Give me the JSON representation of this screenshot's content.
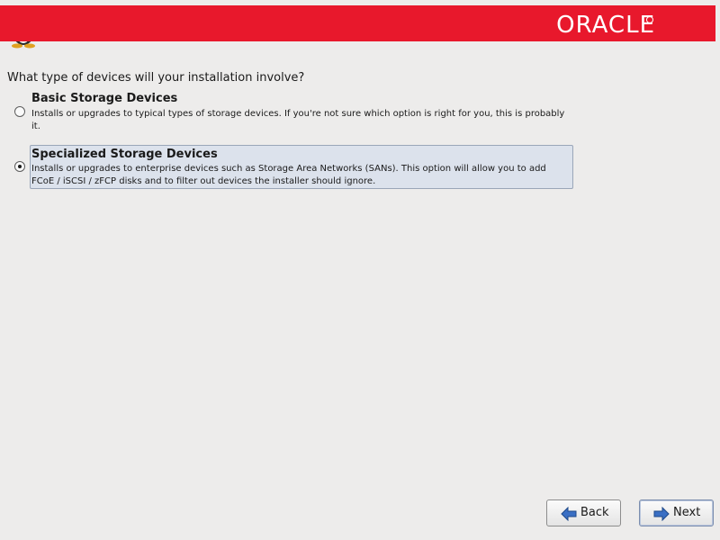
{
  "header": {
    "logo_text": "ORACLE",
    "banner_color": "#e8182c",
    "icon": "tux-penguin-icon"
  },
  "main": {
    "question": "What type of devices will your installation involve?",
    "options": [
      {
        "title": "Basic Storage Devices",
        "description": "Installs or upgrades to typical types of storage devices.  If you're not sure which option is right for you, this is probably it.",
        "selected": false
      },
      {
        "title": "Specialized Storage Devices",
        "description": "Installs or upgrades to enterprise devices such as Storage Area Networks (SANs). This option will allow you to add FCoE / iSCSI / zFCP disks and to filter out devices the installer should ignore.",
        "selected": true
      }
    ]
  },
  "footer": {
    "back_label": "Back",
    "next_label": "Next",
    "back_icon": "arrow-left-icon",
    "next_icon": "arrow-right-icon"
  }
}
